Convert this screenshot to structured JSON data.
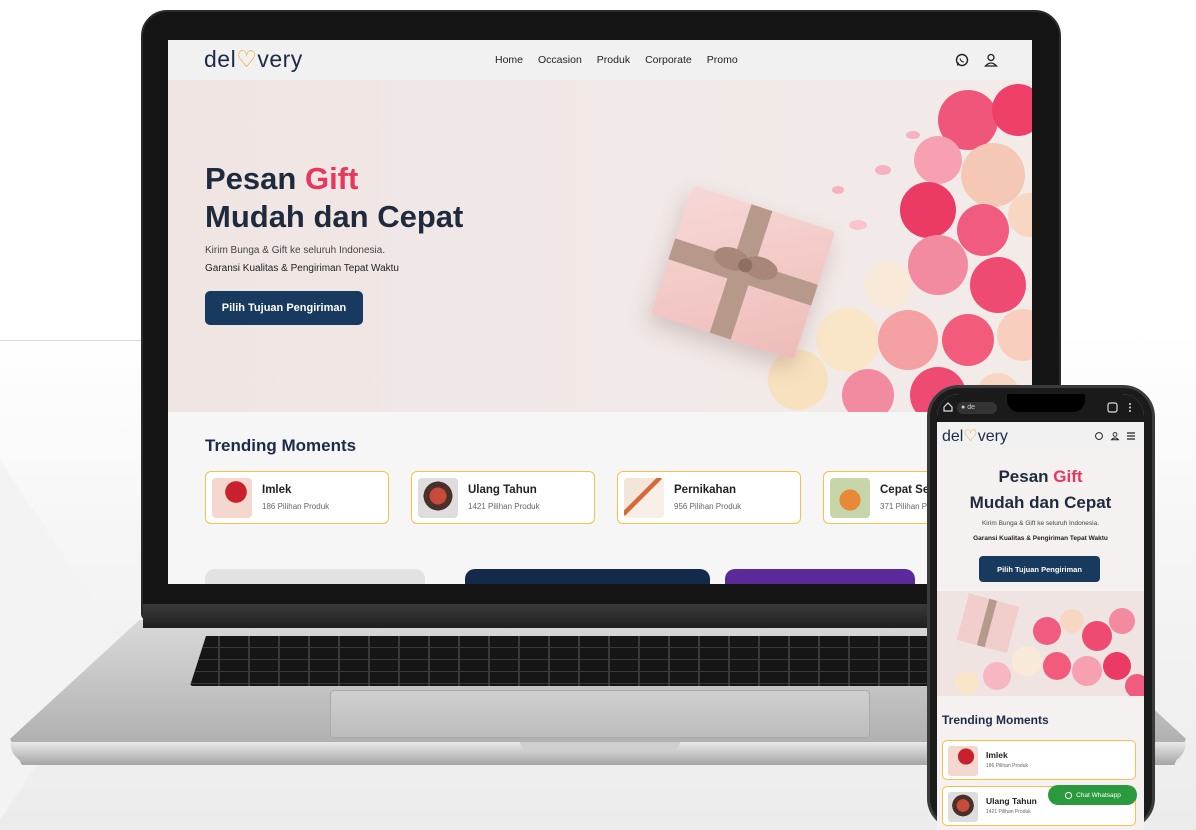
{
  "brand": {
    "logo_pre": "del",
    "logo_heart": "♡",
    "logo_post": "very",
    "accent": "#e8365d",
    "navy": "#173a5e"
  },
  "nav": {
    "items": [
      "Home",
      "Occasion",
      "Produk",
      "Corporate",
      "Promo"
    ]
  },
  "hero": {
    "title_pre": "Pesan ",
    "title_accent": "Gift",
    "title_line2": "Mudah dan Cepat",
    "subtitle1": "Kirim Bunga & Gift ke seluruh Indonesia.",
    "subtitle2": "Garansi Kualitas & Pengiriman Tepat Waktu",
    "cta": "Pilih Tujuan Pengiriman"
  },
  "trending": {
    "title": "Trending Moments",
    "items": [
      {
        "name": "Imlek",
        "count": "186 Pilihan Produk"
      },
      {
        "name": "Ulang Tahun",
        "count": "1421 Pilihan Produk"
      },
      {
        "name": "Pernikahan",
        "count": "956 Pilihan Produk"
      },
      {
        "name": "Cepat Se",
        "count": "371 Pilihan P"
      }
    ]
  },
  "mobile": {
    "url": "de",
    "trend_items": [
      {
        "name": "Imlek",
        "count": "186 Pilihan Produk"
      },
      {
        "name": "Ulang Tahun",
        "count": "1421 Pilihan Produk"
      }
    ],
    "chat_label": "Chat Whatsapp"
  },
  "icons": [
    "whatsapp-icon",
    "user-icon",
    "menu-icon",
    "home-icon",
    "lock-icon",
    "tabs-icon",
    "more-icon"
  ]
}
